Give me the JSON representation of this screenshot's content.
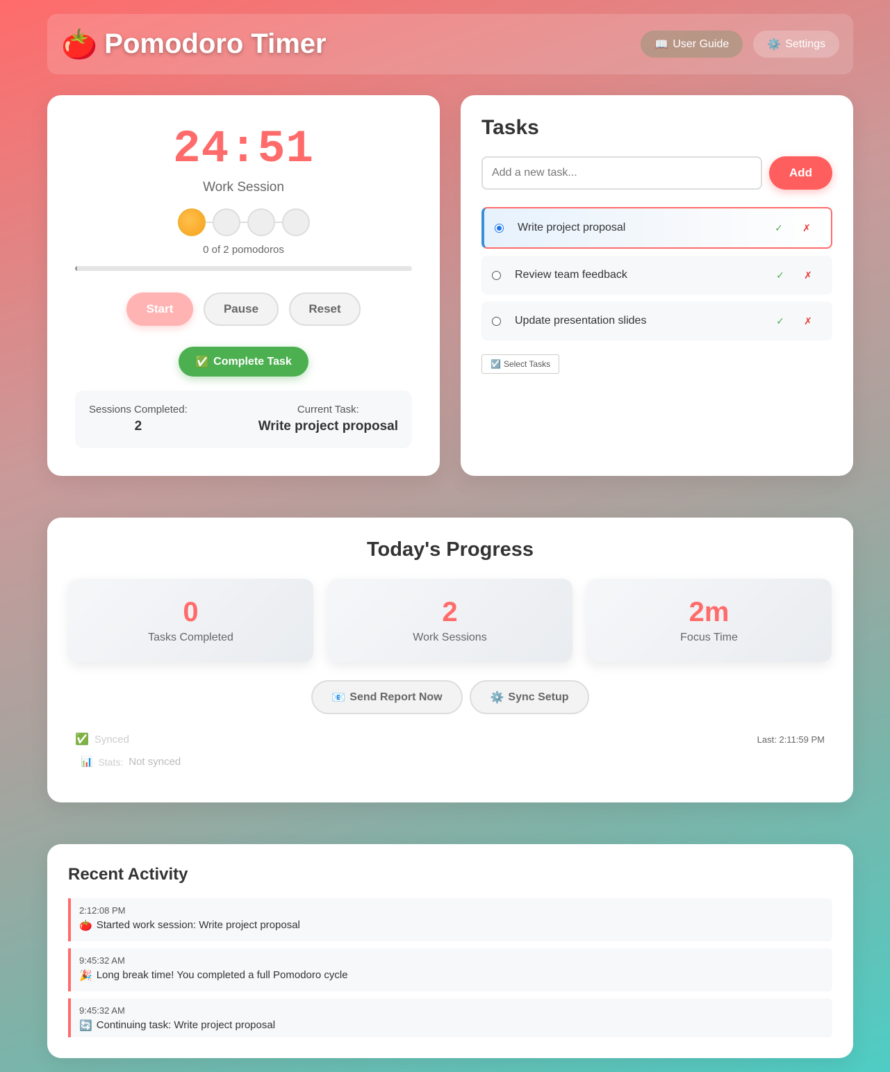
{
  "header": {
    "title": "Pomodoro Timer",
    "logo_icon": "🍅",
    "guide_icon": "📖",
    "guide_label": "User Guide",
    "settings_icon": "⚙️",
    "settings_label": "Settings"
  },
  "timer": {
    "display": "24:51",
    "session_label": "Work Session",
    "pomodoro_dots": [
      true,
      false,
      false,
      false
    ],
    "pomodoro_count": "0 of 2 pomodoros",
    "progress_fraction": 0.006,
    "start_label": "Start",
    "pause_label": "Pause",
    "reset_label": "Reset",
    "complete_icon": "✅",
    "complete_label": "Complete Task",
    "sessions_completed_label": "Sessions Completed:",
    "sessions_completed_value": "2",
    "current_task_label": "Current Task:",
    "current_task_value": "Write project proposal"
  },
  "tasks": {
    "title": "Tasks",
    "input_placeholder": "Add a new task...",
    "add_label": "Add",
    "items": [
      {
        "name": "Write project proposal",
        "selected": true
      },
      {
        "name": "Review team feedback",
        "selected": false
      },
      {
        "name": "Update presentation slides",
        "selected": false
      }
    ],
    "complete_glyph": "✓",
    "delete_glyph": "✗",
    "select_icon": "☑️",
    "select_label": "Select Tasks"
  },
  "progress": {
    "title": "Today's Progress",
    "stats": [
      {
        "value": "0",
        "label": "Tasks Completed"
      },
      {
        "value": "2",
        "label": "Work Sessions"
      },
      {
        "value": "2m",
        "label": "Focus Time"
      }
    ],
    "send_report_icon": "📧",
    "send_report_label": "Send Report Now",
    "sync_setup_icon": "⚙️",
    "sync_setup_label": "Sync Setup",
    "sync_status_icon": "✅",
    "sync_status": "Synced",
    "last_sync": "Last: 2:11:59 PM",
    "stats_icon": "📊",
    "stats_label": "Stats:",
    "stats_value": "Not synced"
  },
  "activity": {
    "title": "Recent Activity",
    "items": [
      {
        "time": "2:12:08 PM",
        "icon": "🍅",
        "message": "Started work session: Write project proposal"
      },
      {
        "time": "9:45:32 AM",
        "icon": "🎉",
        "message": "Long break time! You completed a full Pomodoro cycle"
      },
      {
        "time": "9:45:32 AM",
        "icon": "🔄",
        "message": "Continuing task: Write project proposal"
      }
    ]
  }
}
